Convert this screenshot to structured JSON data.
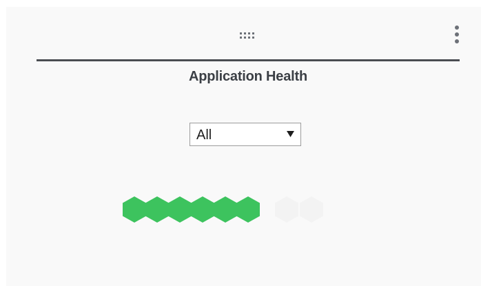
{
  "widget": {
    "title": "Application Health",
    "drag_icon": "grip-dots-icon",
    "menu_icon": "kebab-menu-icon"
  },
  "filter": {
    "selected": "All",
    "arrow_icon": "dropdown-triangle-icon"
  },
  "health": {
    "healthy_color": "#3dc35e",
    "app_count": 6,
    "status": [
      "healthy",
      "healthy",
      "healthy",
      "healthy",
      "healthy",
      "healthy"
    ]
  },
  "colors": {
    "panel_background": "#f9f9f9",
    "divider": "#4a4d52",
    "title_text": "#3b3f45"
  }
}
